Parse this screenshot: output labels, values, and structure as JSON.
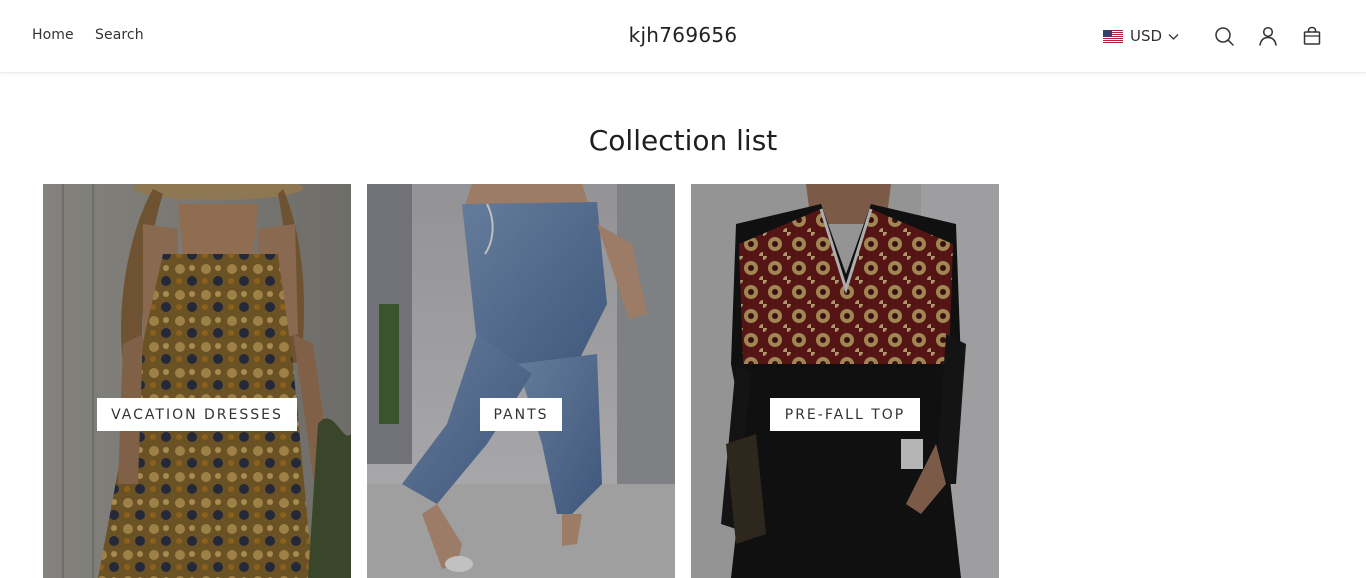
{
  "header": {
    "nav": [
      {
        "label": "Home"
      },
      {
        "label": "Search"
      }
    ],
    "brand": "kjh769656",
    "currency": {
      "code": "USD",
      "flag": "us-flag-icon"
    },
    "icons": [
      "search-icon",
      "account-icon",
      "cart-icon"
    ]
  },
  "main": {
    "title": "Collection list",
    "collections": [
      {
        "label": "VACATION DRESSES"
      },
      {
        "label": "PANTS"
      },
      {
        "label": "PRE-FALL TOP"
      }
    ]
  },
  "colors": {
    "text": "#222222",
    "header_bg": "#ffffff",
    "label_bg": "#ffffff",
    "image_overlay": "rgba(0,0,0,0.25)"
  }
}
